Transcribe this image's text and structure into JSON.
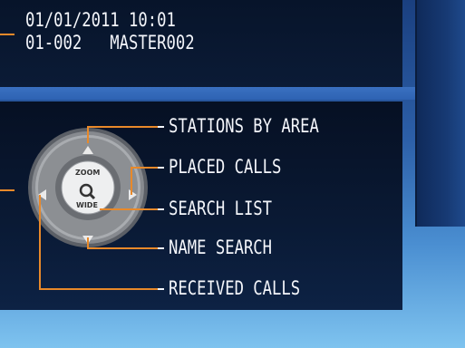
{
  "status": {
    "datetime": "01/01/2011 10:01",
    "station": "01-002   MASTER002"
  },
  "wheel": {
    "zoom_label": "ZOOM",
    "wide_label": "WIDE",
    "search_icon": "magnifier-icon"
  },
  "menu": {
    "stations_by_area": "STATIONS BY AREA",
    "placed_calls": "PLACED CALLS",
    "search_list": "SEARCH LIST",
    "name_search": "NAME SEARCH",
    "received_calls": "RECEIVED CALLS"
  },
  "colors": {
    "callout_line": "#e8892a",
    "panel_bg": "#07142a",
    "text": "#f4f6fb"
  }
}
